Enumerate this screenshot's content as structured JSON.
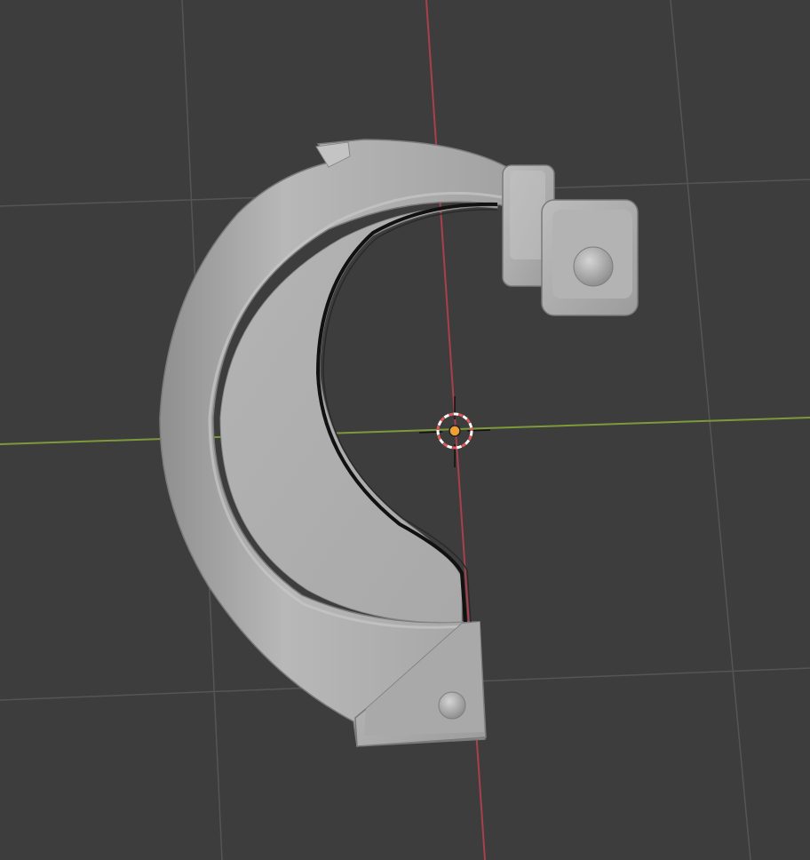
{
  "viewport": {
    "background": "#3d3d3d",
    "grid_color": "#565656",
    "x_axis_color": "#7d9a3a",
    "y_axis_color": "#a8404d"
  },
  "scene": {
    "object": {
      "name": "",
      "surface_color": "#aeaeae",
      "edge_color": "#1a1a1a"
    },
    "cursor": {
      "icon": "3d-cursor-icon",
      "ring_colors": [
        "#ffffff",
        "#e05a5a"
      ],
      "center_color": "#f0a030"
    }
  }
}
